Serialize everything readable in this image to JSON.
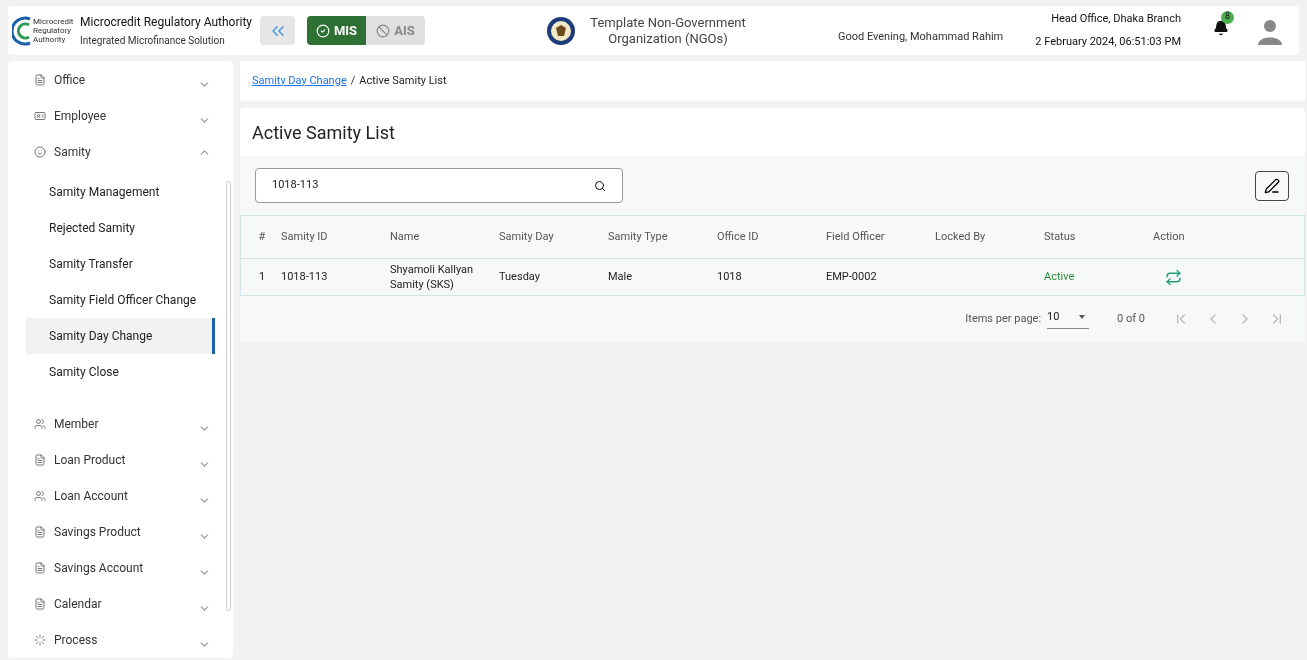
{
  "header": {
    "logo_text": "Microcredit Regulatory Authority",
    "title": "Microcredit Regulatory Authority",
    "subtitle": "Integrated Microfinance Solution",
    "modes": [
      {
        "label": "MIS",
        "selected": true
      },
      {
        "label": "AIS",
        "selected": false
      }
    ],
    "organization": "Template Non-Government Organization (NGOs)",
    "greeting": "Good Evening, Mohammad Rahim",
    "branch": "Head Office, Dhaka Branch",
    "datetime": "2 February 2024, 06:51:03 PM",
    "notifications": "8"
  },
  "sidebar": {
    "items": [
      {
        "label": "Office",
        "kind": "doc",
        "expanded": false
      },
      {
        "label": "Employee",
        "kind": "badge",
        "expanded": false
      },
      {
        "label": "Samity",
        "kind": "group",
        "expanded": true,
        "children": [
          {
            "label": "Samity Management",
            "selected": false
          },
          {
            "label": "Rejected Samity",
            "selected": false
          },
          {
            "label": "Samity Transfer",
            "selected": false
          },
          {
            "label": "Samity Field Officer Change",
            "selected": false
          },
          {
            "label": "Samity Day Change",
            "selected": true
          },
          {
            "label": "Samity Close",
            "selected": false
          }
        ]
      },
      {
        "label": "Member",
        "kind": "people",
        "expanded": false
      },
      {
        "label": "Loan Product",
        "kind": "doc",
        "expanded": false
      },
      {
        "label": "Loan Account",
        "kind": "people",
        "expanded": false
      },
      {
        "label": "Savings Product",
        "kind": "doc",
        "expanded": false
      },
      {
        "label": "Savings Account",
        "kind": "doc",
        "expanded": false
      },
      {
        "label": "Calendar",
        "kind": "doc",
        "expanded": false
      },
      {
        "label": "Process",
        "kind": "process",
        "expanded": false
      }
    ]
  },
  "breadcrumb_separator": "/",
  "breadcrumb": [
    {
      "label": "Samity Day Change",
      "kind": "link"
    },
    {
      "label": "Active Samity List",
      "kind": "current"
    }
  ],
  "page_title": "Active Samity List",
  "search": {
    "value": "1018-113"
  },
  "table": {
    "columns": [
      "#",
      "Samity ID",
      "Name",
      "Samity Day",
      "Samity Type",
      "Office ID",
      "Field Officer",
      "Locked By",
      "Status",
      "Action"
    ],
    "rows": [
      {
        "cells": [
          "1",
          "1018-113",
          "Shyamoli Kallyan Samity (SKS)",
          "Tuesday",
          "Male",
          "1018",
          "EMP-0002",
          "",
          "Active"
        ]
      }
    ]
  },
  "paginator": {
    "label": "Items per page:",
    "page_size": "10",
    "range": "0 of 0",
    "first_disabled": true,
    "prev_disabled": true,
    "next_disabled": true,
    "last_disabled": true
  }
}
